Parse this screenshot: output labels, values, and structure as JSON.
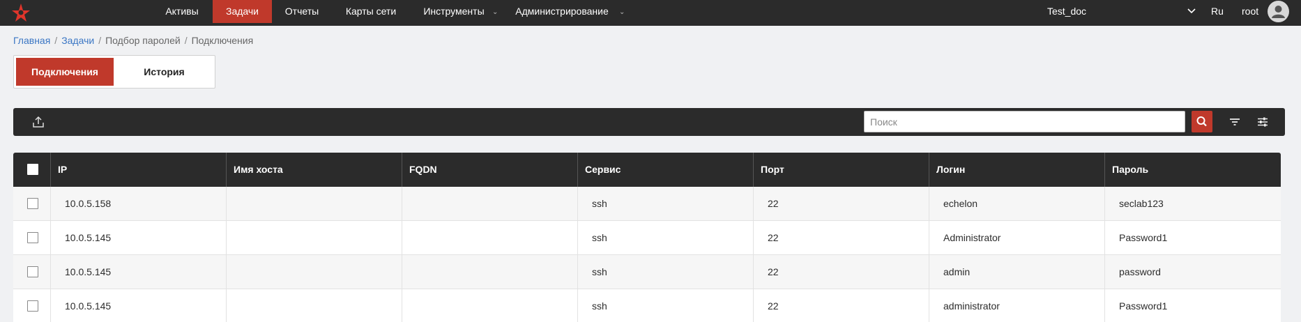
{
  "nav": {
    "items": [
      {
        "label": "Активы",
        "active": false,
        "dropdown": false
      },
      {
        "label": "Задачи",
        "active": true,
        "dropdown": false
      },
      {
        "label": "Отчеты",
        "active": false,
        "dropdown": false
      },
      {
        "label": "Карты сети",
        "active": false,
        "dropdown": false
      },
      {
        "label": "Инструменты",
        "active": false,
        "dropdown": true
      },
      {
        "label": "Администрирование",
        "active": false,
        "dropdown": true
      }
    ],
    "project": "Test_doc",
    "language": "Ru",
    "user": "root"
  },
  "breadcrumb": {
    "home": "Главная",
    "tasks": "Задачи",
    "bruteforce": "Подбор паролей",
    "current": "Подключения",
    "separator": "/"
  },
  "tabs": {
    "connections": "Подключения",
    "history": "История"
  },
  "toolbar": {
    "search_placeholder": "Поиск"
  },
  "table": {
    "columns": [
      "IP",
      "Имя хоста",
      "FQDN",
      "Сервис",
      "Порт",
      "Логин",
      "Пароль"
    ],
    "rows": [
      {
        "ip": "10.0.5.158",
        "hostname": "",
        "fqdn": "",
        "service": "ssh",
        "port": "22",
        "login": "echelon",
        "password": "seclab123"
      },
      {
        "ip": "10.0.5.145",
        "hostname": "",
        "fqdn": "",
        "service": "ssh",
        "port": "22",
        "login": "Administrator",
        "password": "Password1"
      },
      {
        "ip": "10.0.5.145",
        "hostname": "",
        "fqdn": "",
        "service": "ssh",
        "port": "22",
        "login": "admin",
        "password": "password"
      },
      {
        "ip": "10.0.5.145",
        "hostname": "",
        "fqdn": "",
        "service": "ssh",
        "port": "22",
        "login": "administrator",
        "password": "Password1"
      }
    ]
  },
  "colors": {
    "accent": "#c0392b",
    "topbar": "#2b2b2b",
    "link": "#3a76c4"
  }
}
